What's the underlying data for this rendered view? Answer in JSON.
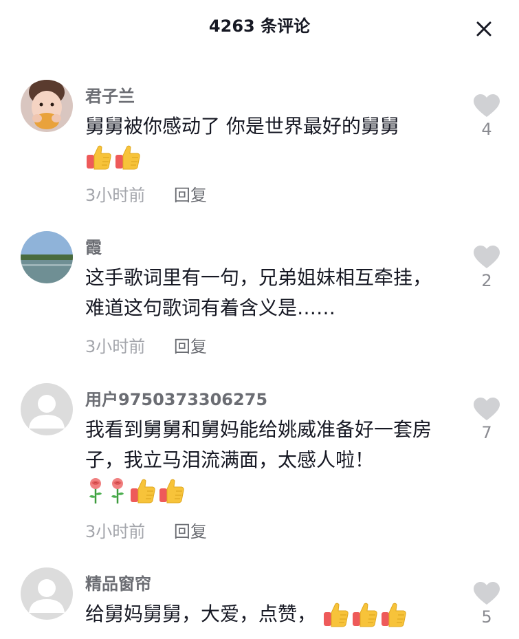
{
  "header": {
    "title": "4263 条评论"
  },
  "comments": [
    {
      "username": "君子兰",
      "text": "舅舅被你感动了 你是世界最好的舅舅",
      "emojis": [
        "thumbs-up",
        "thumbs-up"
      ],
      "time": "3小时前",
      "reply_label": "回复",
      "likes": "4"
    },
    {
      "username": "霞",
      "text": "这手歌词里有一句，兄弟姐妹相互牵挂，难道这句歌词有着含义是……",
      "emojis": [],
      "time": "3小时前",
      "reply_label": "回复",
      "likes": "2"
    },
    {
      "username": "用户9750373306275",
      "text": "我看到舅舅和舅妈能给姚威准备好一套房子，我立马泪流满面，太感人啦！",
      "emojis": [
        "rose",
        "rose",
        "thumbs-up",
        "thumbs-up"
      ],
      "time": "3小时前",
      "reply_label": "回复",
      "likes": "7"
    },
    {
      "username": "精品窗帘",
      "text": "给舅妈舅舅，大爱，点赞，",
      "emojis": [
        "thumbs-up",
        "thumbs-up",
        "thumbs-up"
      ],
      "time": "",
      "reply_label": "",
      "likes": "5"
    }
  ],
  "colors": {
    "username": "#6b6d73",
    "meta": "#a3a5ab",
    "heart": "#d0d1d4",
    "thumb": "#f7c33a"
  },
  "icons": {
    "close": "close-icon",
    "like": "heart-icon",
    "default_avatar": "default-avatar-icon"
  }
}
